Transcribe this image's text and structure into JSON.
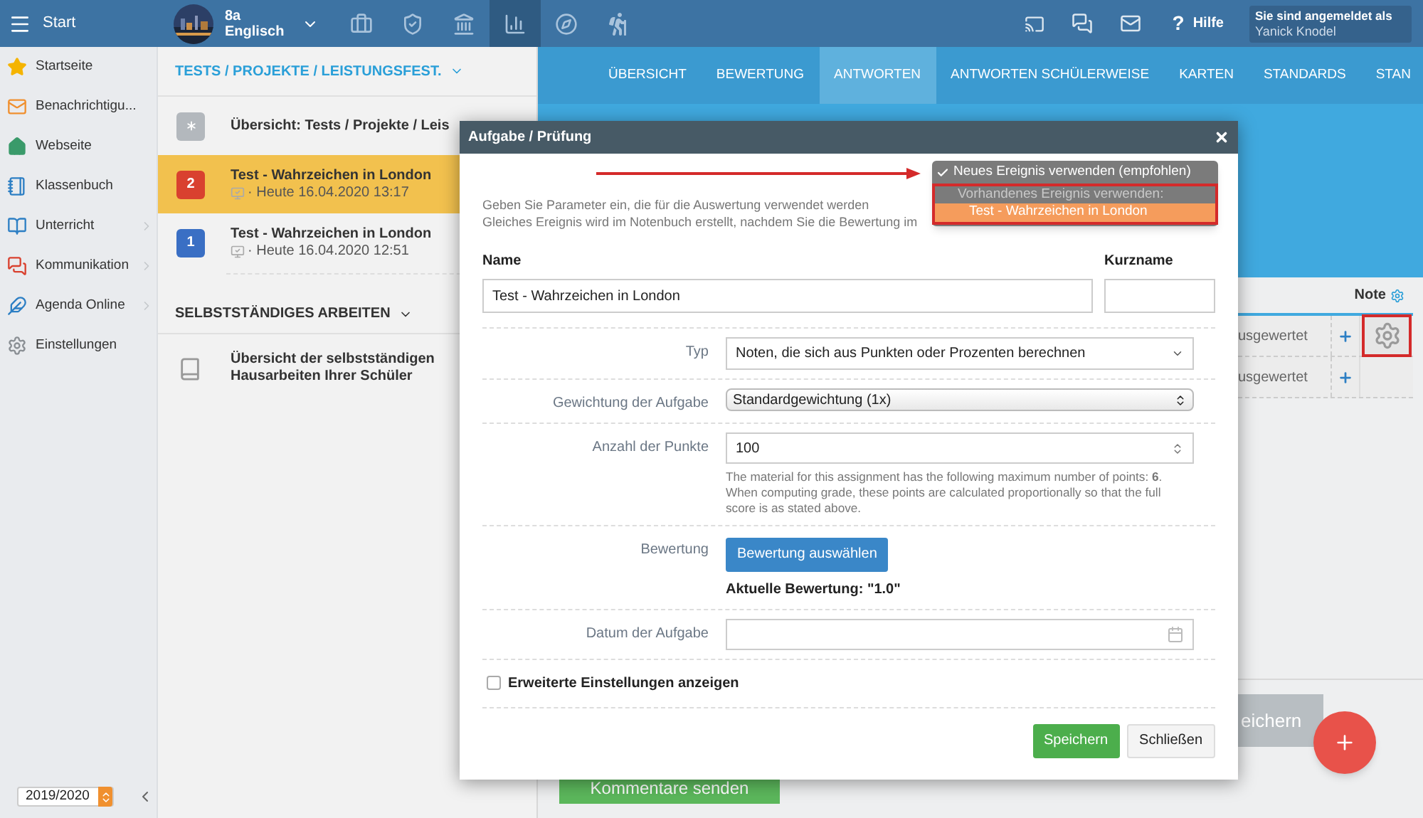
{
  "top_bar": {
    "start_label": "Start",
    "class_name": "8a",
    "subject": "Englisch",
    "help": {
      "glyph": "?",
      "label": "Hilfe"
    },
    "user": {
      "caption": "Sie sind angemeldet als",
      "name": "Yanick Knodel"
    },
    "tools": [
      {
        "selected": false
      },
      {
        "selected": false
      },
      {
        "selected": false
      },
      {
        "selected": true
      },
      {
        "selected": false
      },
      {
        "selected": false
      }
    ]
  },
  "sidebar": {
    "items": [
      {
        "label": "Startseite",
        "has_children": false
      },
      {
        "label": "Benachrichtigu...",
        "has_children": false
      },
      {
        "label": "Webseite",
        "has_children": false
      },
      {
        "label": "Klassenbuch",
        "has_children": false
      },
      {
        "label": "Unterricht",
        "has_children": true
      },
      {
        "label": "Kommunikation",
        "has_children": true
      },
      {
        "label": "Agenda Online",
        "has_children": true
      },
      {
        "label": "Einstellungen",
        "has_children": false
      }
    ],
    "year": "2019/2020"
  },
  "assignments": {
    "heading": "TESTS / PROJEKTE / LEISTUNGSFEST.",
    "items": [
      {
        "kind": "overview",
        "title": "Übersicht: Tests / Projekte / Leis",
        "selected": false
      },
      {
        "kind": "test",
        "badge": "2",
        "color": "#d9412f",
        "title": "Test - Wahrzeichen in London",
        "meta": "· Heute 16.04.2020 13:17",
        "selected": true
      },
      {
        "kind": "test",
        "badge": "1",
        "color": "#3a6fc4",
        "title": "Test - Wahrzeichen in London",
        "meta": "· Heute 16.04.2020 12:51",
        "selected": false
      }
    ]
  },
  "self_study": {
    "heading": "SELBSTSTÄNDIGES ARBEITEN",
    "item": "Übersicht der selbstständigen Hausarbeiten Ihrer Schüler"
  },
  "tabs": [
    {
      "label": "ÜBERSICHT",
      "selected": false
    },
    {
      "label": "BEWERTUNG",
      "selected": false
    },
    {
      "label": "ANTWORTEN",
      "selected": true
    },
    {
      "label": "ANTWORTEN SCHÜLERWEISE",
      "selected": false
    },
    {
      "label": "KARTEN",
      "selected": false
    },
    {
      "label": "STANDARDS",
      "selected": false
    },
    {
      "label": "STAN",
      "selected": false
    }
  ],
  "grade_table": {
    "column": "Note",
    "rows": [
      {
        "status": "usgewertet",
        "note_highlighted": true
      },
      {
        "status": "usgewertet",
        "note_highlighted": false
      }
    ]
  },
  "page_buttons": {
    "save": "eichern",
    "send": "Kommentare senden"
  },
  "dialog": {
    "title": "Aufgabe / Prüfung",
    "event_menu": [
      {
        "kind": "option",
        "label": "Neues Ereignis verwenden (empfohlen)",
        "checked": true,
        "highlighted": false
      },
      {
        "kind": "group",
        "label": "Vorhandenes Ereignis verwenden:"
      },
      {
        "kind": "option",
        "label": "Test - Wahrzeichen in London",
        "checked": false,
        "highlighted": true
      }
    ],
    "description": [
      "Geben Sie Parameter ein, die für die Auswertung verwendet werden",
      "Gleiches Ereignis wird im Notenbuch erstellt, nachdem Sie die Bewertung im"
    ],
    "name_label": "Name",
    "name_value": "Test - Wahrzeichen in London",
    "short_label": "Kurzname",
    "type_label": "Typ",
    "type_value": "Noten, die sich aus Punkten oder Prozenten berechnen",
    "weight_label": "Gewichtung der Aufgabe",
    "weight_value": "Standardgewichtung (1x)",
    "points_label": "Anzahl der Punkte",
    "points_value": "100",
    "points_help": "The material for this assignment has the following maximum number of points: **6**. When computing grade, these points are calculated proportionally so that the full score is as stated above.",
    "grading_label": "Bewertung",
    "grading_button": "Bewertung auswählen",
    "grading_current": "Aktuelle Bewertung: \"1.0\"",
    "date_label": "Datum der Aufgabe",
    "advanced": {
      "label": "Erweiterte Einstellungen anzeigen",
      "checked": false
    },
    "buttons": [
      {
        "kind": "primary",
        "label": "Speichern"
      },
      {
        "kind": "secondary",
        "label": "Schließen"
      }
    ]
  }
}
